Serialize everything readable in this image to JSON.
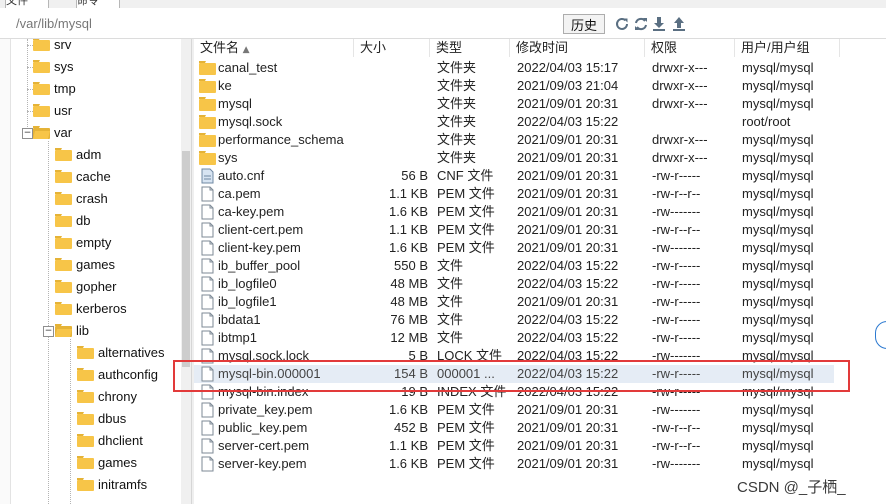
{
  "tabs": [
    {
      "label": "文件",
      "active": true
    },
    {
      "label": "命令",
      "active": false
    }
  ],
  "toolbar": {
    "path": "/var/lib/mysql",
    "history_label": "历史",
    "icons": [
      "refresh-icon",
      "sync-icon",
      "download-icon",
      "upload-icon"
    ]
  },
  "tree": {
    "items": [
      {
        "label": "srv",
        "level": 1
      },
      {
        "label": "sys",
        "level": 1
      },
      {
        "label": "tmp",
        "level": 1
      },
      {
        "label": "usr",
        "level": 1
      },
      {
        "label": "var",
        "level": 1,
        "expanded": true
      },
      {
        "label": "adm",
        "level": 2
      },
      {
        "label": "cache",
        "level": 2
      },
      {
        "label": "crash",
        "level": 2
      },
      {
        "label": "db",
        "level": 2
      },
      {
        "label": "empty",
        "level": 2
      },
      {
        "label": "games",
        "level": 2
      },
      {
        "label": "gopher",
        "level": 2
      },
      {
        "label": "kerberos",
        "level": 2
      },
      {
        "label": "lib",
        "level": 2,
        "expanded": true
      },
      {
        "label": "alternatives",
        "level": 3
      },
      {
        "label": "authconfig",
        "level": 3
      },
      {
        "label": "chrony",
        "level": 3
      },
      {
        "label": "dbus",
        "level": 3
      },
      {
        "label": "dhclient",
        "level": 3
      },
      {
        "label": "games",
        "level": 3
      },
      {
        "label": "initramfs",
        "level": 3
      }
    ]
  },
  "columns": {
    "name": "文件名",
    "size": "大小",
    "type": "类型",
    "modified": "修改时间",
    "perms": "权限",
    "owner": "用户/用户组"
  },
  "files": [
    {
      "name": "canal_test",
      "size": "",
      "type": "文件夹",
      "modified": "2022/04/03 15:17",
      "perms": "drwxr-x---",
      "owner": "mysql/mysql",
      "icon": "folder-icon"
    },
    {
      "name": "ke",
      "size": "",
      "type": "文件夹",
      "modified": "2021/09/03 21:04",
      "perms": "drwxr-x---",
      "owner": "mysql/mysql",
      "icon": "folder-icon"
    },
    {
      "name": "mysql",
      "size": "",
      "type": "文件夹",
      "modified": "2021/09/01 20:31",
      "perms": "drwxr-x---",
      "owner": "mysql/mysql",
      "icon": "folder-icon"
    },
    {
      "name": "mysql.sock",
      "size": "",
      "type": "文件夹",
      "modified": "2022/04/03 15:22",
      "perms": "",
      "owner": "root/root",
      "icon": "folder-icon"
    },
    {
      "name": "performance_schema",
      "size": "",
      "type": "文件夹",
      "modified": "2021/09/01 20:31",
      "perms": "drwxr-x---",
      "owner": "mysql/mysql",
      "icon": "folder-icon"
    },
    {
      "name": "sys",
      "size": "",
      "type": "文件夹",
      "modified": "2021/09/01 20:31",
      "perms": "drwxr-x---",
      "owner": "mysql/mysql",
      "icon": "folder-icon"
    },
    {
      "name": "auto.cnf",
      "size": "56 B",
      "type": "CNF 文件",
      "modified": "2021/09/01 20:31",
      "perms": "-rw-r-----",
      "owner": "mysql/mysql",
      "icon": "config-file-icon"
    },
    {
      "name": "ca.pem",
      "size": "1.1 KB",
      "type": "PEM 文件",
      "modified": "2021/09/01 20:31",
      "perms": "-rw-r--r--",
      "owner": "mysql/mysql",
      "icon": "file-icon"
    },
    {
      "name": "ca-key.pem",
      "size": "1.6 KB",
      "type": "PEM 文件",
      "modified": "2021/09/01 20:31",
      "perms": "-rw-------",
      "owner": "mysql/mysql",
      "icon": "file-icon"
    },
    {
      "name": "client-cert.pem",
      "size": "1.1 KB",
      "type": "PEM 文件",
      "modified": "2021/09/01 20:31",
      "perms": "-rw-r--r--",
      "owner": "mysql/mysql",
      "icon": "file-icon"
    },
    {
      "name": "client-key.pem",
      "size": "1.6 KB",
      "type": "PEM 文件",
      "modified": "2021/09/01 20:31",
      "perms": "-rw-------",
      "owner": "mysql/mysql",
      "icon": "file-icon"
    },
    {
      "name": "ib_buffer_pool",
      "size": "550 B",
      "type": "文件",
      "modified": "2022/04/03 15:22",
      "perms": "-rw-r-----",
      "owner": "mysql/mysql",
      "icon": "file-icon"
    },
    {
      "name": "ib_logfile0",
      "size": "48 MB",
      "type": "文件",
      "modified": "2022/04/03 15:22",
      "perms": "-rw-r-----",
      "owner": "mysql/mysql",
      "icon": "file-icon"
    },
    {
      "name": "ib_logfile1",
      "size": "48 MB",
      "type": "文件",
      "modified": "2021/09/01 20:31",
      "perms": "-rw-r-----",
      "owner": "mysql/mysql",
      "icon": "file-icon"
    },
    {
      "name": "ibdata1",
      "size": "76 MB",
      "type": "文件",
      "modified": "2022/04/03 15:22",
      "perms": "-rw-r-----",
      "owner": "mysql/mysql",
      "icon": "file-icon"
    },
    {
      "name": "ibtmp1",
      "size": "12 MB",
      "type": "文件",
      "modified": "2022/04/03 15:22",
      "perms": "-rw-r-----",
      "owner": "mysql/mysql",
      "icon": "file-icon"
    },
    {
      "name": "mysql.sock.lock",
      "size": "5 B",
      "type": "LOCK 文件",
      "modified": "2022/04/03 15:22",
      "perms": "-rw-------",
      "owner": "mysql/mysql",
      "icon": "file-icon"
    },
    {
      "name": "mysql-bin.000001",
      "size": "154 B",
      "type": "000001 ...",
      "modified": "2022/04/03 15:22",
      "perms": "-rw-r-----",
      "owner": "mysql/mysql",
      "icon": "file-icon",
      "selected": true
    },
    {
      "name": "mysql-bin.index",
      "size": "19 B",
      "type": "INDEX 文件",
      "modified": "2022/04/03 15:22",
      "perms": "-rw-r-----",
      "owner": "mysql/mysql",
      "icon": "file-icon"
    },
    {
      "name": "private_key.pem",
      "size": "1.6 KB",
      "type": "PEM 文件",
      "modified": "2021/09/01 20:31",
      "perms": "-rw-------",
      "owner": "mysql/mysql",
      "icon": "file-icon"
    },
    {
      "name": "public_key.pem",
      "size": "452 B",
      "type": "PEM 文件",
      "modified": "2021/09/01 20:31",
      "perms": "-rw-r--r--",
      "owner": "mysql/mysql",
      "icon": "file-icon"
    },
    {
      "name": "server-cert.pem",
      "size": "1.1 KB",
      "type": "PEM 文件",
      "modified": "2021/09/01 20:31",
      "perms": "-rw-r--r--",
      "owner": "mysql/mysql",
      "icon": "file-icon"
    },
    {
      "name": "server-key.pem",
      "size": "1.6 KB",
      "type": "PEM 文件",
      "modified": "2021/09/01 20:31",
      "perms": "-rw-------",
      "owner": "mysql/mysql",
      "icon": "file-icon"
    }
  ],
  "watermark": "CSDN @_子栖_",
  "colors": {
    "folder": "#f7c548",
    "highlight_border": "#e23a3a",
    "selected_row": "#e5ecf5",
    "toolbar_icon": "#5a6f82"
  }
}
